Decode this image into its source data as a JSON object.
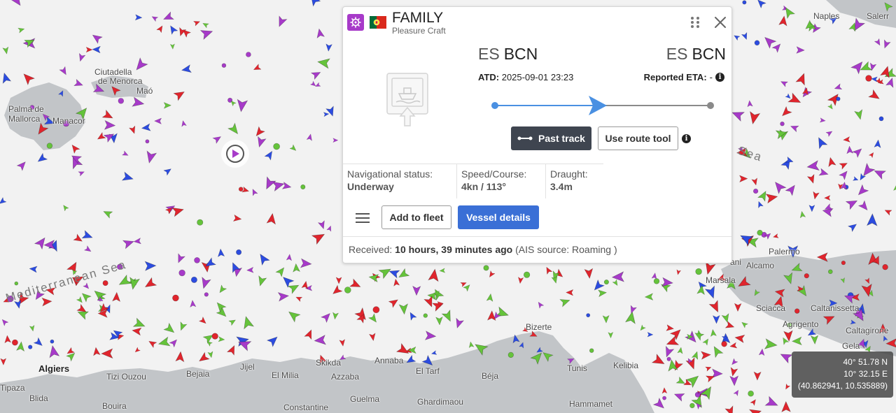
{
  "map": {
    "sea_labels": {
      "mediterranean": "Mediterranean Sea",
      "tyrrhenian_fragment": "n Sea"
    },
    "places": [
      {
        "key": "palma",
        "text": "Palma de",
        "big": false
      },
      {
        "key": "palma2",
        "text": "Mallorca",
        "big": false
      },
      {
        "key": "ciutadella",
        "text": "Ciutadella",
        "big": false
      },
      {
        "key": "menorca",
        "text": "de Menorca",
        "big": false
      },
      {
        "key": "mao",
        "text": "Maó",
        "big": false
      },
      {
        "key": "manacor",
        "text": "Manacor",
        "big": false
      },
      {
        "key": "algiers",
        "text": "Algiers",
        "big": true
      },
      {
        "key": "tipaza",
        "text": "Tipaza",
        "big": false
      },
      {
        "key": "blida",
        "text": "Blida",
        "big": false
      },
      {
        "key": "bouira",
        "text": "Bouira",
        "big": false
      },
      {
        "key": "tiziouzou",
        "text": "Tizi Ouzou",
        "big": false
      },
      {
        "key": "bejaia",
        "text": "Bejaia",
        "big": false
      },
      {
        "key": "jijel",
        "text": "Jijel",
        "big": false
      },
      {
        "key": "elmilia",
        "text": "El Milia",
        "big": false
      },
      {
        "key": "skikda",
        "text": "Skikda",
        "big": false
      },
      {
        "key": "azzaba",
        "text": "Azzaba",
        "big": false
      },
      {
        "key": "annaba",
        "text": "Annaba",
        "big": false
      },
      {
        "key": "eltarf",
        "text": "El Tarf",
        "big": false
      },
      {
        "key": "constantine",
        "text": "Constantine",
        "big": false
      },
      {
        "key": "guelma",
        "text": "Guelma",
        "big": false
      },
      {
        "key": "ghardimaou",
        "text": "Ghardimaou",
        "big": false
      },
      {
        "key": "beja",
        "text": "Béja",
        "big": false
      },
      {
        "key": "bizerte",
        "text": "Bizerte",
        "big": false
      },
      {
        "key": "tunis",
        "text": "Tunis",
        "big": false
      },
      {
        "key": "kelibia",
        "text": "Kelibia",
        "big": false
      },
      {
        "key": "hammamet",
        "text": "Hammamet",
        "big": false
      },
      {
        "key": "marsala",
        "text": "Marsala",
        "big": false
      },
      {
        "key": "alcamo",
        "text": "Alcamo",
        "big": false
      },
      {
        "key": "palermo",
        "text": "Palermo",
        "big": false
      },
      {
        "key": "sciacca",
        "text": "Sciacca",
        "big": false
      },
      {
        "key": "caltanissetta",
        "text": "Caltanissetta",
        "big": false
      },
      {
        "key": "agrigento",
        "text": "Agrigento",
        "big": false
      },
      {
        "key": "caltagirone",
        "text": "Caltagirone",
        "big": false
      },
      {
        "key": "gela",
        "text": "Gela",
        "big": false
      },
      {
        "key": "naples",
        "text": "Naples",
        "big": false
      },
      {
        "key": "salerno",
        "text": "Salerr",
        "big": false
      },
      {
        "key": "ani",
        "text": "ani",
        "big": false
      }
    ]
  },
  "popup": {
    "vessel_name": "FAMILY",
    "vessel_type": "Pleasure Craft",
    "flag_country": "Portugal",
    "type_color": "#a73ac9",
    "departure": {
      "country": "ES",
      "port": "BCN"
    },
    "arrival": {
      "country": "ES",
      "port": "BCN"
    },
    "atd_label": "ATD:",
    "atd_value": "2025-09-01 23:23",
    "eta_label": "Reported ETA:",
    "eta_value": "-",
    "voyage_progress": 0.5,
    "past_track_label": "Past track",
    "route_tool_label": "Use route tool",
    "stats": [
      {
        "label": "Navigational status:",
        "value": "Underway"
      },
      {
        "label": "Speed/Course:",
        "value": "4kn / 113°"
      },
      {
        "label": "Draught:",
        "value": "3.4m"
      }
    ],
    "add_fleet_label": "Add to fleet",
    "details_label": "Vessel details",
    "received_label": "Received:",
    "received_value": "10 hours, 39 minutes ago",
    "source_text": "(AIS source: Roaming )"
  },
  "coords": {
    "lat": "40° 51.78 N",
    "lon": "10° 32.15 E",
    "decimal": "(40.862941, 10.535889)"
  },
  "colors": {
    "sea": "#f2f2f2",
    "land": "#c2c5c8",
    "cargo": "#65c33b",
    "tanker": "#e0252d",
    "passenger": "#2c4ce0",
    "pleasure": "#a73ac9",
    "accent": "#3a6fd6"
  }
}
